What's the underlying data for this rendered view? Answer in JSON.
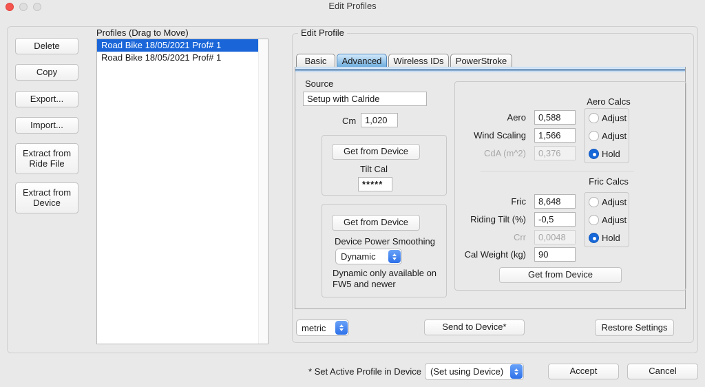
{
  "window": {
    "title": "Edit Profiles"
  },
  "left_panel": {
    "buttons": [
      {
        "label": "Delete"
      },
      {
        "label": "Copy"
      },
      {
        "label": "Export..."
      },
      {
        "label": "Import..."
      },
      {
        "label": "Extract from Ride File"
      },
      {
        "label": "Extract from Device"
      }
    ]
  },
  "profiles": {
    "label": "Profiles (Drag to Move)",
    "items": [
      {
        "label": "Road Bike 18/05/2021 Prof# 1",
        "selected": true
      },
      {
        "label": "Road Bike 18/05/2021 Prof# 1",
        "selected": false
      }
    ]
  },
  "edit_profile": {
    "label": "Edit Profile",
    "tabs": [
      {
        "label": "Basic",
        "selected": false
      },
      {
        "label": "Advanced",
        "selected": true
      },
      {
        "label": "Wireless IDs",
        "selected": false
      },
      {
        "label": "PowerStroke",
        "selected": false
      }
    ],
    "source": {
      "label": "Source",
      "value": "Setup with Calride",
      "cm_label": "Cm",
      "cm_value": "1,020"
    },
    "tilt_group": {
      "get_button": "Get from Device",
      "tilt_label": "Tilt Cal",
      "tilt_value": "*****"
    },
    "smoothing_group": {
      "get_button": "Get from Device",
      "label": "Device Power Smoothing",
      "dropdown_value": "Dynamic",
      "note_line1": "Dynamic only available on",
      "note_line2": "FW5 and newer"
    },
    "calcs": {
      "aero": {
        "title": "Aero Calcs",
        "rows": [
          {
            "label": "Aero",
            "value": "0,588",
            "disabled": false
          },
          {
            "label": "Wind Scaling",
            "value": "1,566",
            "disabled": false
          },
          {
            "label": "CdA (m^2)",
            "value": "0,376",
            "disabled": true
          }
        ],
        "radios": [
          {
            "label": "Adjust",
            "selected": false
          },
          {
            "label": "Adjust",
            "selected": false
          },
          {
            "label": "Hold",
            "selected": true
          }
        ]
      },
      "fric": {
        "title": "Fric Calcs",
        "rows": [
          {
            "label": "Fric",
            "value": "8,648",
            "disabled": false
          },
          {
            "label": "Riding Tilt (%)",
            "value": "-0,5",
            "disabled": false
          },
          {
            "label": "Crr",
            "value": "0,0048",
            "disabled": true
          },
          {
            "label": "Cal Weight (kg)",
            "value": "90",
            "disabled": false
          }
        ],
        "radios": [
          {
            "label": "Adjust",
            "selected": false
          },
          {
            "label": "Adjust",
            "selected": false
          },
          {
            "label": "Hold",
            "selected": true
          }
        ]
      },
      "get_button": "Get from Device"
    },
    "units_dropdown": {
      "value": "metric"
    },
    "send_button": "Send to Device*",
    "restore_button": "Restore Settings"
  },
  "footer": {
    "label": "* Set Active Profile in Device",
    "dropdown_value": "(Set using Device)",
    "accept": "Accept",
    "cancel": "Cancel"
  },
  "icons": {
    "stepper": "up-down-chevrons",
    "traffic_lights": [
      "close",
      "minimize",
      "zoom"
    ]
  },
  "colors": {
    "selection_blue": "#1a66d9",
    "stepper_blue": "#2e71e9",
    "tab_selected_blue": "#6fadde"
  }
}
